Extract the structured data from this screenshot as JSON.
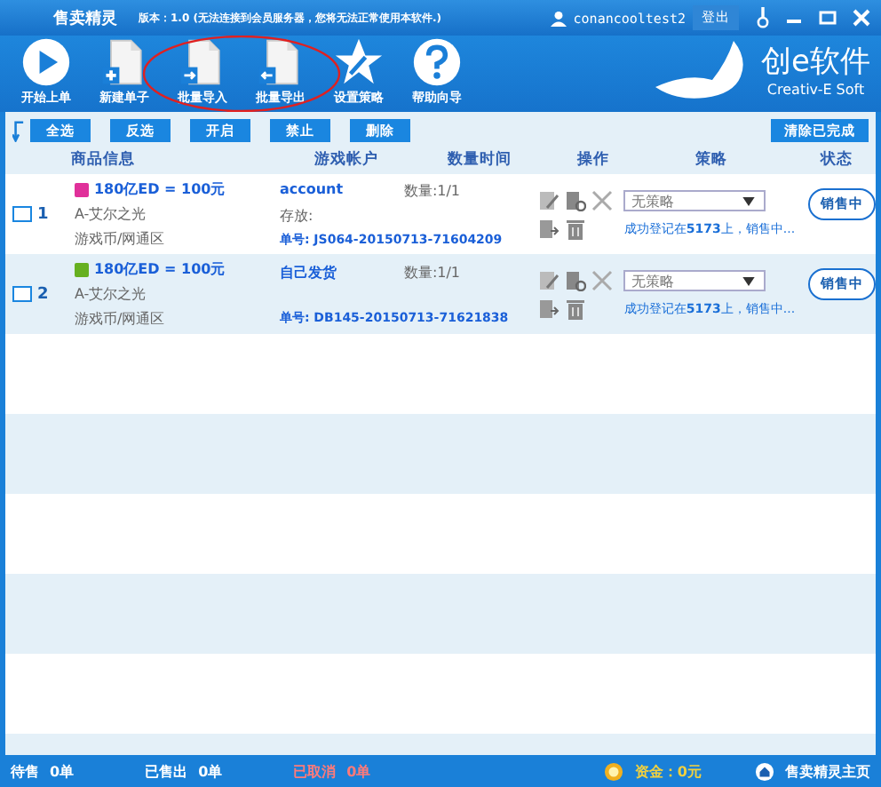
{
  "window": {
    "title": "售卖精灵",
    "version": "版本：1.0 (无法连接到会员服务器，您将无法正常使用本软件.)",
    "user": "conancooltest2",
    "logout": "登出"
  },
  "toolbar": [
    {
      "label": "开始上单",
      "kind": "play"
    },
    {
      "label": "新建单子",
      "kind": "new"
    },
    {
      "label": "批量导入",
      "kind": "import"
    },
    {
      "label": "批量导出",
      "kind": "export"
    },
    {
      "label": "设置策略",
      "kind": "settings"
    },
    {
      "label": "帮助向导",
      "kind": "help"
    }
  ],
  "logo": {
    "name": "创e软件",
    "tagline": "Creativ-E Soft"
  },
  "actions": [
    "全选",
    "反选",
    "开启",
    "禁止",
    "删除"
  ],
  "clear_button": "清除已完成",
  "columns": [
    "商品信息",
    "游戏帐户",
    "数量时间",
    "操作",
    "策略",
    "状态"
  ],
  "rows": [
    {
      "checked": false,
      "index": "1",
      "color": "#e0309a",
      "product": "180亿ED = 100元",
      "server": "A-艾尔之光",
      "category": "游戏币/网通区",
      "account": "account",
      "storage": "存放:",
      "quantity": "数量:1/1",
      "order": "单号: JS064-20150713-71604209",
      "strategy": "无策略",
      "message": "成功登记在**5173**上，销售中...",
      "status": "销售中"
    },
    {
      "checked": false,
      "index": "2",
      "color": "#66b020",
      "product": "180亿ED = 100元",
      "server": "A-艾尔之光",
      "category": "游戏币/网通区",
      "account": "自己发货",
      "quantity": "数量:1/1",
      "order": "单号: DB145-20150713-71621838",
      "strategy": "无策略",
      "message": "成功登记在**5173**上，销售中...",
      "status": "销售中"
    }
  ],
  "status_bar": {
    "pending": "待售",
    "pending_count": "0单",
    "sold": "已售出",
    "sold_count": "0单",
    "cancelled": "已取消",
    "cancelled_count": "0单",
    "funds": "资金：0元",
    "home": "售卖精灵主页"
  }
}
